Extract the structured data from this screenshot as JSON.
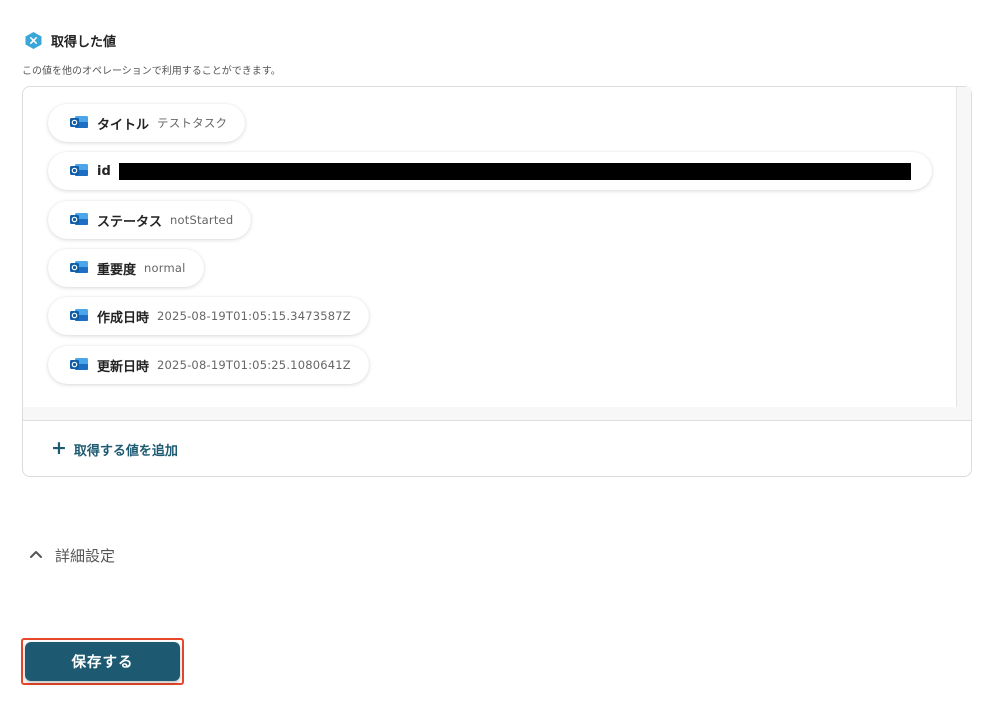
{
  "section": {
    "title": "取得した値",
    "description": "この値を他のオペレーションで利用することができます。"
  },
  "values": [
    {
      "key": "タイトル",
      "value": "テストタスク"
    },
    {
      "key": "id",
      "value": "",
      "redacted": true
    },
    {
      "key": "ステータス",
      "value": "notStarted"
    },
    {
      "key": "重要度",
      "value": "normal"
    },
    {
      "key": "作成日時",
      "value": "2025-08-19T01:05:15.3473587Z"
    },
    {
      "key": "更新日時",
      "value": "2025-08-19T01:05:25.1080641Z"
    }
  ],
  "add_value": {
    "plus": "+",
    "label": "取得する値を追加"
  },
  "detail": {
    "label": "詳細設定"
  },
  "save": {
    "label": "保存する"
  },
  "colors": {
    "accent": "#1d5a72",
    "highlight": "#e8472c",
    "badge": "#3aa7d8"
  }
}
